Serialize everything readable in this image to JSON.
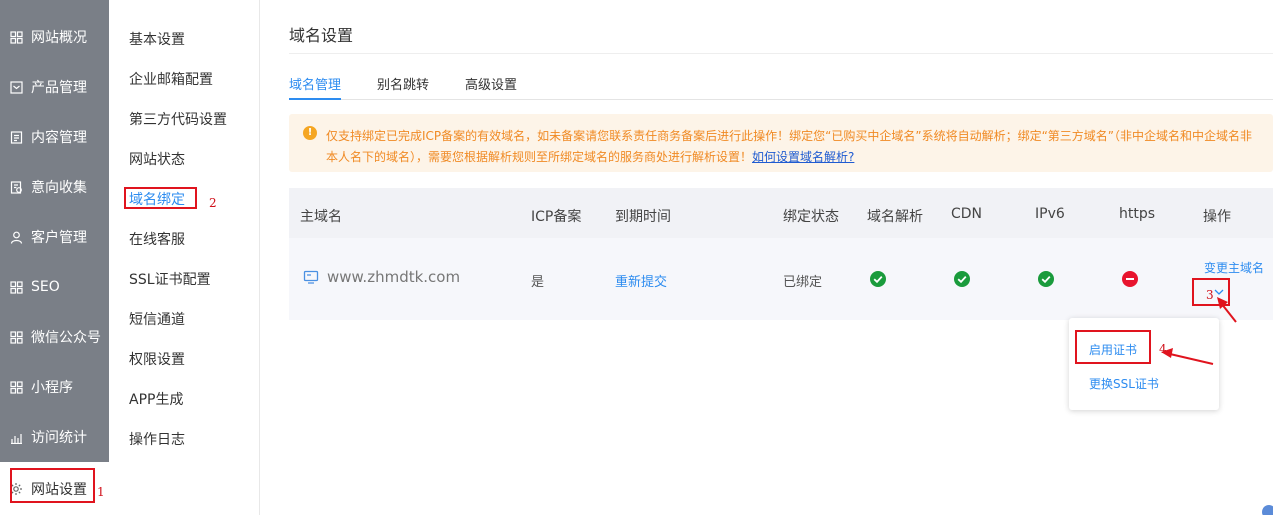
{
  "sidebar": {
    "items": [
      {
        "label": "网站概况",
        "icon": "grid-icon"
      },
      {
        "label": "产品管理",
        "icon": "box-icon"
      },
      {
        "label": "内容管理",
        "icon": "document-icon"
      },
      {
        "label": "意向收集",
        "icon": "form-icon"
      },
      {
        "label": "客户管理",
        "icon": "user-icon"
      },
      {
        "label": "SEO",
        "icon": "grid-icon"
      },
      {
        "label": "微信公众号",
        "icon": "grid-icon"
      },
      {
        "label": "小程序",
        "icon": "grid-icon"
      },
      {
        "label": "访问统计",
        "icon": "bar-chart-icon"
      },
      {
        "label": "网站设置",
        "icon": "gear-icon",
        "active": true
      }
    ]
  },
  "submenu": {
    "items": [
      "基本设置",
      "企业邮箱配置",
      "第三方代码设置",
      "网站状态",
      "域名绑定",
      "在线客服",
      "SSL证书配置",
      "短信通道",
      "权限设置",
      "APP生成",
      "操作日志"
    ],
    "active": "域名绑定"
  },
  "page": {
    "title": "域名设置",
    "tabs": [
      "域名管理",
      "别名跳转",
      "高级设置"
    ],
    "active_tab": "域名管理"
  },
  "notice": {
    "text": "仅支持绑定已完成ICP备案的有效域名，如未备案请您联系责任商务备案后进行此操作！绑定您“已购买中企域名”系统将自动解析；绑定“第三方域名”（非中企域名和中企域名非本人名下的域名），需要您根据解析规则至所绑定域名的服务商处进行解析设置！",
    "link": "如何设置域名解析?"
  },
  "table": {
    "headers": [
      "主域名",
      "ICP备案",
      "到期时间",
      "绑定状态",
      "域名解析",
      "CDN",
      "IPv6",
      "https",
      "操作"
    ],
    "row": {
      "domain": "www.zhmdtk.com",
      "icp": "是",
      "expiry": "重新提交",
      "status": "已绑定",
      "dns": "ok",
      "cdn": "ok",
      "ipv6": "ok",
      "https": "error",
      "action": "变更主域名"
    }
  },
  "popup": {
    "items": [
      "启用证书",
      "更换SSL证书"
    ]
  },
  "annotations": {
    "labels": [
      "1",
      "2",
      "3",
      "4"
    ]
  },
  "colors": {
    "sidebar_bg": "#7a7f87",
    "accent": "#2d8cf0",
    "notice_bg": "#fdf4e8",
    "notice_text": "#f08a24",
    "ok": "#1a9b3c",
    "error": "#e8142e",
    "annotation": "#e0141e"
  }
}
